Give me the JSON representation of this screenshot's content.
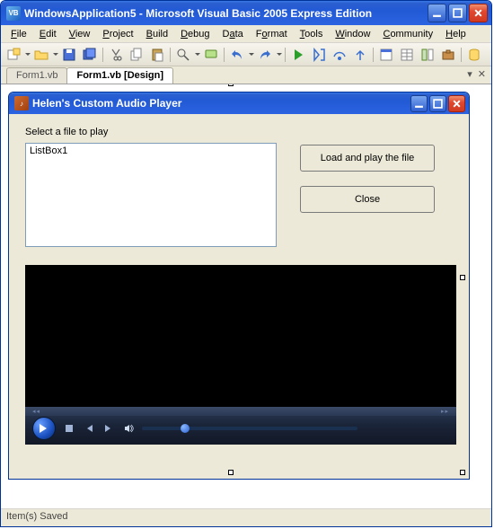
{
  "window": {
    "title": "WindowsApplication5 - Microsoft Visual Basic 2005 Express Edition",
    "app_icon_text": "VB"
  },
  "menu": {
    "items": [
      {
        "text": "File",
        "u": "F"
      },
      {
        "text": "Edit",
        "u": "E"
      },
      {
        "text": "View",
        "u": "V"
      },
      {
        "text": "Project",
        "u": "P"
      },
      {
        "text": "Build",
        "u": "B"
      },
      {
        "text": "Debug",
        "u": "D"
      },
      {
        "text": "Data",
        "u": "a"
      },
      {
        "text": "Format",
        "u": "o"
      },
      {
        "text": "Tools",
        "u": "T"
      },
      {
        "text": "Window",
        "u": "W"
      },
      {
        "text": "Community",
        "u": "C"
      },
      {
        "text": "Help",
        "u": "H"
      }
    ]
  },
  "tabs": {
    "items": [
      {
        "label": "Form1.vb",
        "active": false
      },
      {
        "label": "Form1.vb [Design]",
        "active": true
      }
    ]
  },
  "childWindow": {
    "title": "Helen's Custom Audio Player"
  },
  "form": {
    "prompt": "Select a file to play",
    "listbox_item": "ListBox1",
    "load_button": "Load and play the file",
    "close_button": "Close"
  },
  "status": {
    "text": "Item(s) Saved"
  }
}
